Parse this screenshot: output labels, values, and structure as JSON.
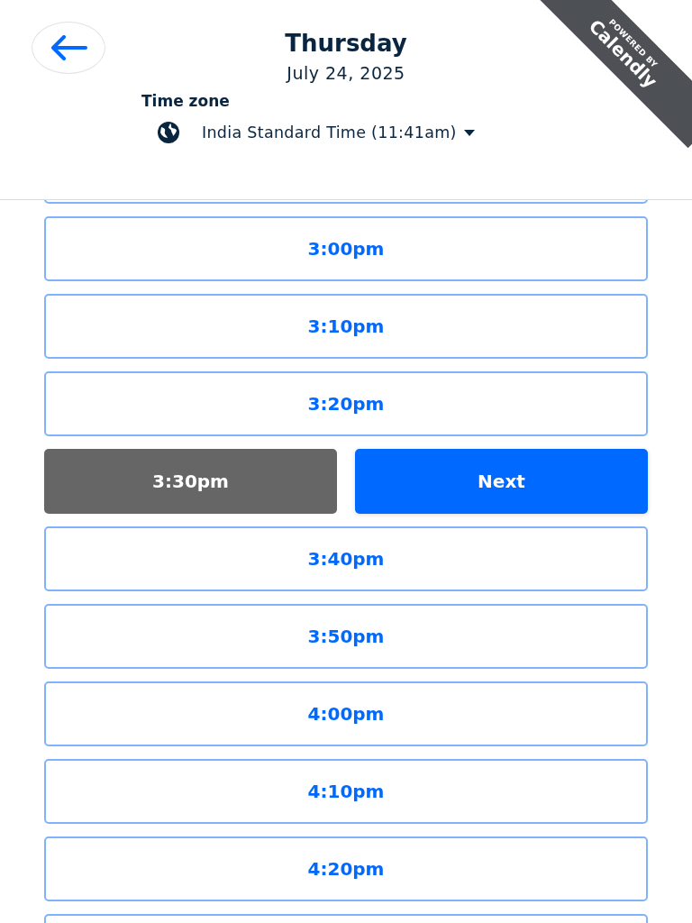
{
  "header": {
    "title": "Thursday",
    "date": "July 24, 2025",
    "timezone_label": "Time zone",
    "timezone_value": "India Standard Time (11:41am)"
  },
  "badge": {
    "line_1": "POWERED BY",
    "line_2": "Calendly"
  },
  "slots": [
    {
      "time": "3:00pm",
      "selected": false
    },
    {
      "time": "3:10pm",
      "selected": false
    },
    {
      "time": "3:20pm",
      "selected": false
    },
    {
      "time": "3:30pm",
      "selected": true
    },
    {
      "time": "3:40pm",
      "selected": false
    },
    {
      "time": "3:50pm",
      "selected": false
    },
    {
      "time": "4:00pm",
      "selected": false
    },
    {
      "time": "4:10pm",
      "selected": false
    },
    {
      "time": "4:20pm",
      "selected": false
    }
  ],
  "confirm_button": "Next"
}
